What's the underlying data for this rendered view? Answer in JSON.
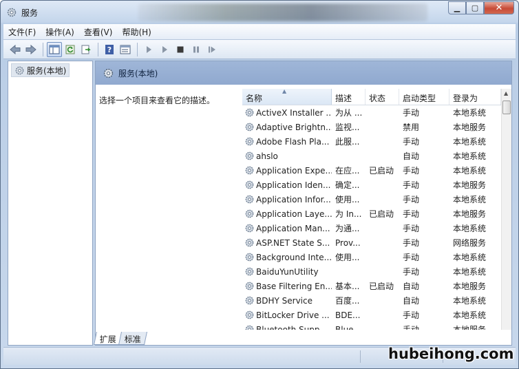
{
  "window": {
    "title": "服务"
  },
  "menu": [
    "文件(F)",
    "操作(A)",
    "查看(V)",
    "帮助(H)"
  ],
  "toolbar": {
    "buttons": [
      "back-icon",
      "forward-icon",
      "show-hide-tree-icon",
      "refresh-icon",
      "export-list-icon",
      "help-icon",
      "properties-icon",
      "start-service-icon",
      "start-paused-icon",
      "stop-service-icon",
      "pause-service-icon",
      "restart-service-icon"
    ]
  },
  "tree": {
    "root_label": "服务(本地)"
  },
  "main": {
    "header_title": "服务(本地)",
    "description_prompt": "选择一个项目来查看它的描述。"
  },
  "columns": [
    "名称",
    "描述",
    "状态",
    "启动类型",
    "登录为"
  ],
  "services": [
    {
      "name": "ActiveX Installer ...",
      "desc": "为从 ...",
      "status": "",
      "startup": "手动",
      "logon": "本地系统"
    },
    {
      "name": "Adaptive Brightn...",
      "desc": "监视...",
      "status": "",
      "startup": "禁用",
      "logon": "本地服务"
    },
    {
      "name": "Adobe Flash Pla...",
      "desc": "此服...",
      "status": "",
      "startup": "手动",
      "logon": "本地系统"
    },
    {
      "name": "ahslo",
      "desc": "",
      "status": "",
      "startup": "自动",
      "logon": "本地系统"
    },
    {
      "name": "Application Expe...",
      "desc": "在应...",
      "status": "已启动",
      "startup": "手动",
      "logon": "本地系统"
    },
    {
      "name": "Application Iden...",
      "desc": "确定...",
      "status": "",
      "startup": "手动",
      "logon": "本地服务"
    },
    {
      "name": "Application Infor...",
      "desc": "使用...",
      "status": "",
      "startup": "手动",
      "logon": "本地系统"
    },
    {
      "name": "Application Laye...",
      "desc": "为 In...",
      "status": "已启动",
      "startup": "手动",
      "logon": "本地服务"
    },
    {
      "name": "Application Man...",
      "desc": "为通...",
      "status": "",
      "startup": "手动",
      "logon": "本地系统"
    },
    {
      "name": "ASP.NET State S...",
      "desc": "Prov...",
      "status": "",
      "startup": "手动",
      "logon": "网络服务"
    },
    {
      "name": "Background Inte...",
      "desc": "使用...",
      "status": "",
      "startup": "手动",
      "logon": "本地系统"
    },
    {
      "name": "BaiduYunUtility",
      "desc": "",
      "status": "",
      "startup": "手动",
      "logon": "本地系统"
    },
    {
      "name": "Base Filtering En...",
      "desc": "基本...",
      "status": "已启动",
      "startup": "自动",
      "logon": "本地服务"
    },
    {
      "name": "BDHY Service",
      "desc": "百度...",
      "status": "",
      "startup": "自动",
      "logon": "本地系统"
    },
    {
      "name": "BitLocker Drive ...",
      "desc": "BDE...",
      "status": "",
      "startup": "手动",
      "logon": "本地系统"
    },
    {
      "name": "Bluetooth Supp...",
      "desc": "Blue...",
      "status": "",
      "startup": "手动",
      "logon": "本地服务"
    }
  ],
  "tabs": [
    "扩展",
    "标准"
  ],
  "watermark": "hubeihong.com"
}
